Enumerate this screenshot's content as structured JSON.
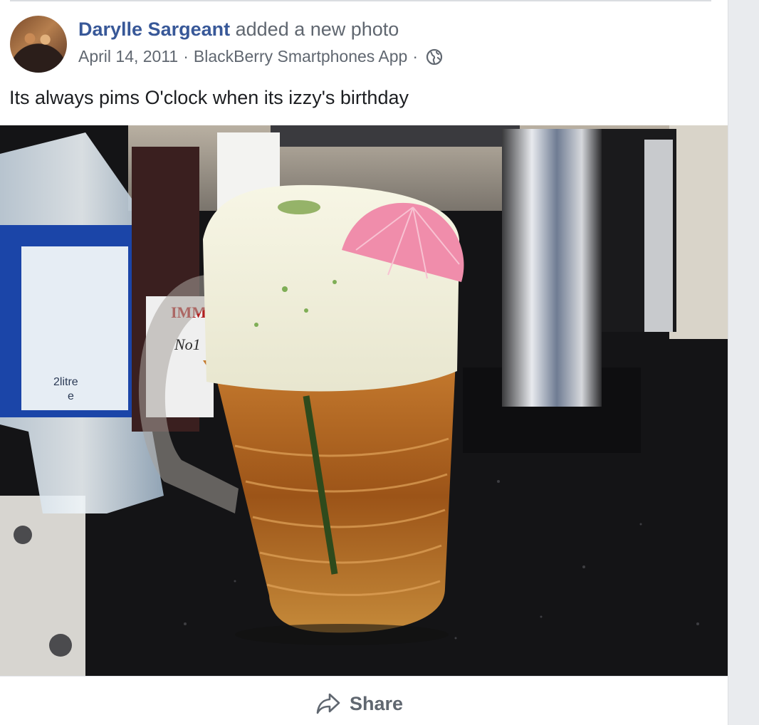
{
  "post": {
    "author_name": "Darylle Sargeant",
    "action_text": "added a new photo",
    "date": "April 14, 2011",
    "separator": "·",
    "source_app": "BlackBerry Smartphones App",
    "privacy_icon": "globe-icon",
    "text": "Its always pims O'clock when its izzy's birthday"
  },
  "photo": {
    "bottle_label_text": "2litre",
    "bottle_label_mark": "e",
    "pimms_label_text": "IMM",
    "pimms_label_number": "No1"
  },
  "actions": {
    "share_label": "Share",
    "share_icon": "share-arrow-icon"
  },
  "colors": {
    "author_link": "#385898",
    "secondary_text": "#606770",
    "body_text": "#1c1e21",
    "page_background": "#e9ebee"
  }
}
